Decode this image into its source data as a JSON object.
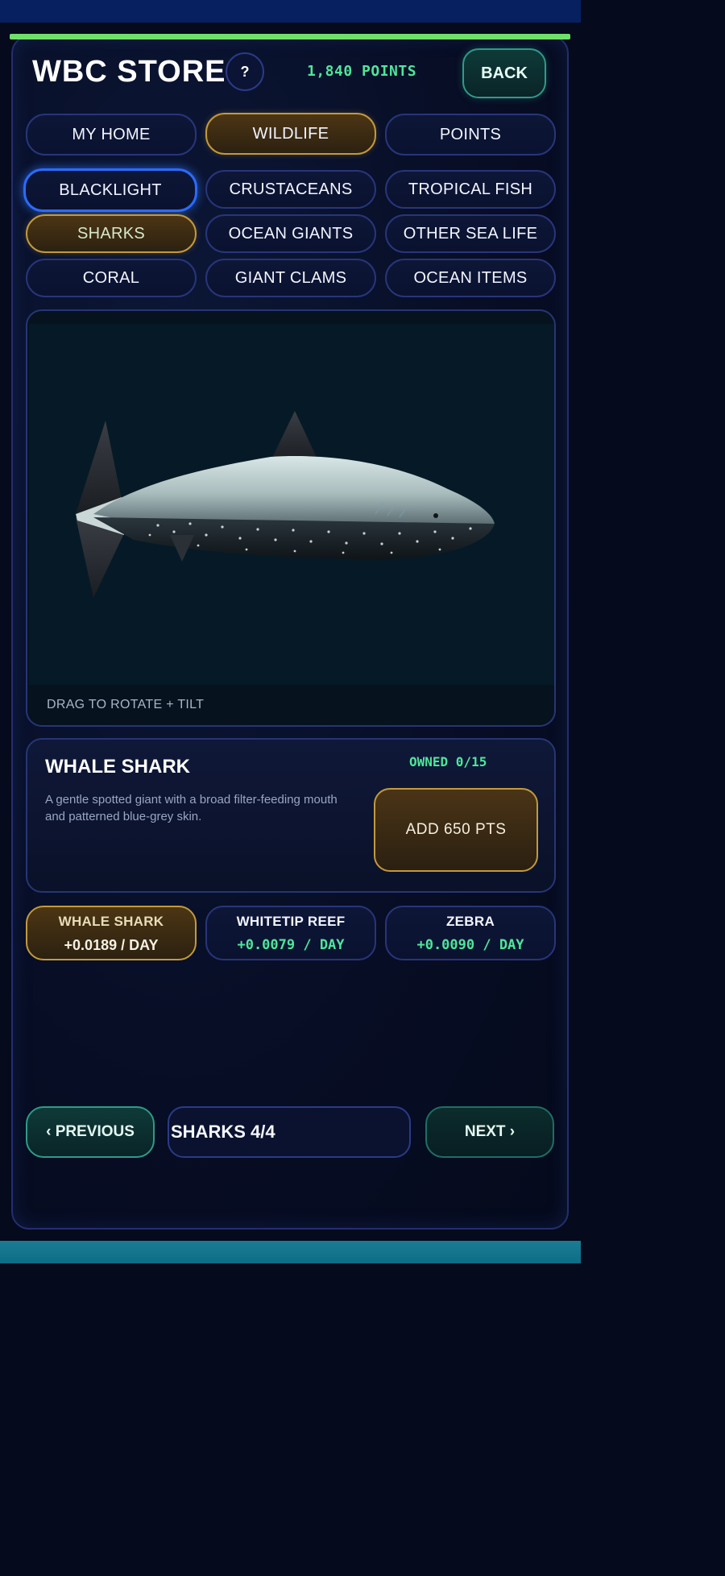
{
  "header": {
    "title": "WBC STORE",
    "help_label": "?",
    "points": "1,840 POINTS",
    "back_label": "BACK"
  },
  "main_tabs": [
    {
      "label": "MY HOME",
      "active": false
    },
    {
      "label": "WILDLIFE",
      "active": true
    },
    {
      "label": "POINTS",
      "active": false
    }
  ],
  "categories": [
    {
      "label": "BLACKLIGHT",
      "state": "focused"
    },
    {
      "label": "CRUSTACEANS",
      "state": "normal"
    },
    {
      "label": "TROPICAL FISH",
      "state": "normal"
    },
    {
      "label": "SHARKS",
      "state": "selected"
    },
    {
      "label": "OCEAN GIANTS",
      "state": "normal"
    },
    {
      "label": "OTHER SEA LIFE",
      "state": "normal"
    },
    {
      "label": "CORAL",
      "state": "normal"
    },
    {
      "label": "GIANT CLAMS",
      "state": "normal"
    },
    {
      "label": "OCEAN ITEMS",
      "state": "normal"
    }
  ],
  "viewer": {
    "hint": "DRAG TO ROTATE + TILT"
  },
  "item": {
    "name": "WHALE SHARK",
    "owned": "OWNED 0/15",
    "description": "A gentle spotted giant with a broad filter-feeding mouth and patterned blue-grey skin.",
    "add_label": "ADD  650 PTS"
  },
  "species": [
    {
      "name": "WHALE SHARK",
      "rate": "+0.0189 / DAY",
      "selected": true
    },
    {
      "name": "WHITETIP REEF",
      "rate": "+0.0079 / DAY",
      "selected": false
    },
    {
      "name": "ZEBRA",
      "rate": "+0.0090 / DAY",
      "selected": false
    }
  ],
  "pager": {
    "prev_label": "‹  PREVIOUS",
    "page_label": "SHARKS  4/4",
    "next_label": "NEXT  ›"
  },
  "colors": {
    "accent_green": "#4ee69a",
    "gold": "#c39a3b",
    "teal": "#2f9b86",
    "focus_blue": "#2b6bff",
    "border_navy": "#28357a"
  }
}
